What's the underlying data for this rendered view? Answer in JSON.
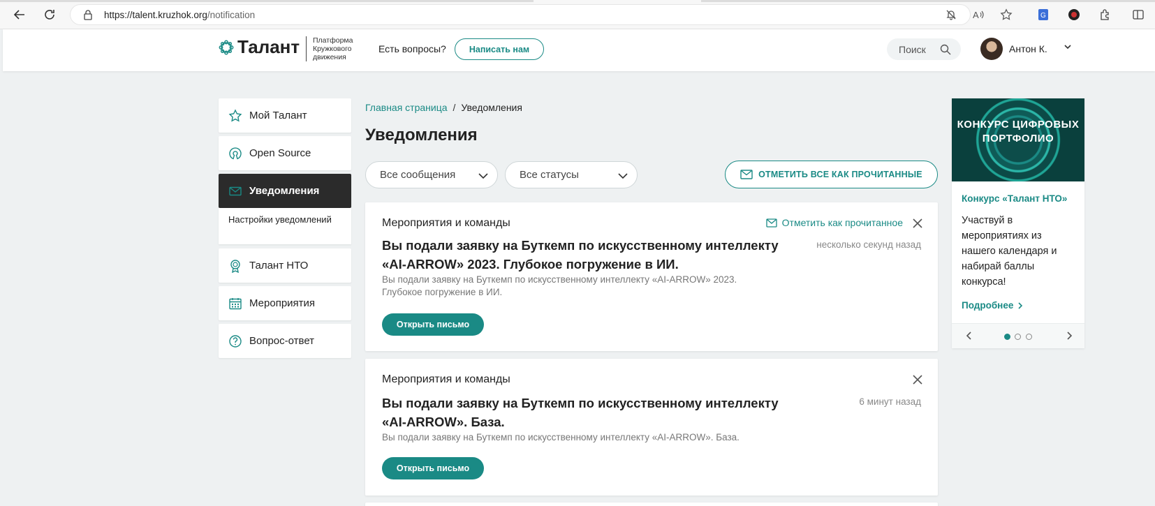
{
  "browser": {
    "url_host": "https://talent.kruzhok.org",
    "url_path": "/notification"
  },
  "header": {
    "logo_text": "Талант",
    "logo_sub": "Платформа Кружкового движения",
    "questions": "Есть вопросы?",
    "write_us": "Написать нам",
    "search_label": "Поиск",
    "user_name": "Антон К."
  },
  "sidebar": {
    "items": [
      {
        "label": "Мой Талант",
        "icon": "star-icon"
      },
      {
        "label": "Open Source",
        "icon": "open-source-icon"
      },
      {
        "label": "Уведомления",
        "icon": "mail-icon",
        "active": true
      },
      {
        "label": "Настройки уведомлений"
      },
      {
        "label": "Талант НТО",
        "icon": "award-icon"
      },
      {
        "label": "Мероприятия",
        "icon": "calendar-icon"
      },
      {
        "label": "Вопрос-ответ",
        "icon": "question-icon"
      }
    ]
  },
  "main": {
    "breadcrumb_home": "Главная страница",
    "breadcrumb_sep": "/",
    "breadcrumb_current": "Уведомления",
    "title": "Уведомления",
    "filter_messages": "Все сообщения",
    "filter_statuses": "Все статусы",
    "mark_all": "ОТМЕТИТЬ ВСЕ КАК ПРОЧИТАННЫЕ",
    "notifications": [
      {
        "category": "Мероприятия и команды",
        "mark_read": "Отметить как прочитанное",
        "title": "Вы подали заявку на Буткемп по искусственному интеллекту «AI-ARROW» 2023. Глубокое погружение в ИИ.",
        "time": "несколько секунд назад",
        "desc": "Вы подали заявку на Буткемп по искусственному интеллекту «AI-ARROW» 2023. Глубокое погружение в ИИ.",
        "button": "Открыть письмо"
      },
      {
        "category": "Мероприятия и команды",
        "title": "Вы подали заявку на Буткемп по искусственному интеллекту «AI-ARROW». База.",
        "time": "6 минут назад",
        "desc": "Вы подали заявку на Буткемп по искусственному интеллекту «AI-ARROW». База.",
        "button": "Открыть письмо"
      }
    ]
  },
  "promo": {
    "image_text": "КОНКУРС ЦИФРОВЫХ ПОРТФОЛИО",
    "title": "Конкурс «Талант НТО»",
    "text": "Участвуй в мероприятиях из нашего календаря и набирай баллы конкурса!",
    "more": "Подробнее",
    "slides": 3,
    "active_slide": 1
  },
  "colors": {
    "accent": "#1a8a85",
    "active_nav": "#2b2b2b",
    "background": "#eef1f2"
  }
}
